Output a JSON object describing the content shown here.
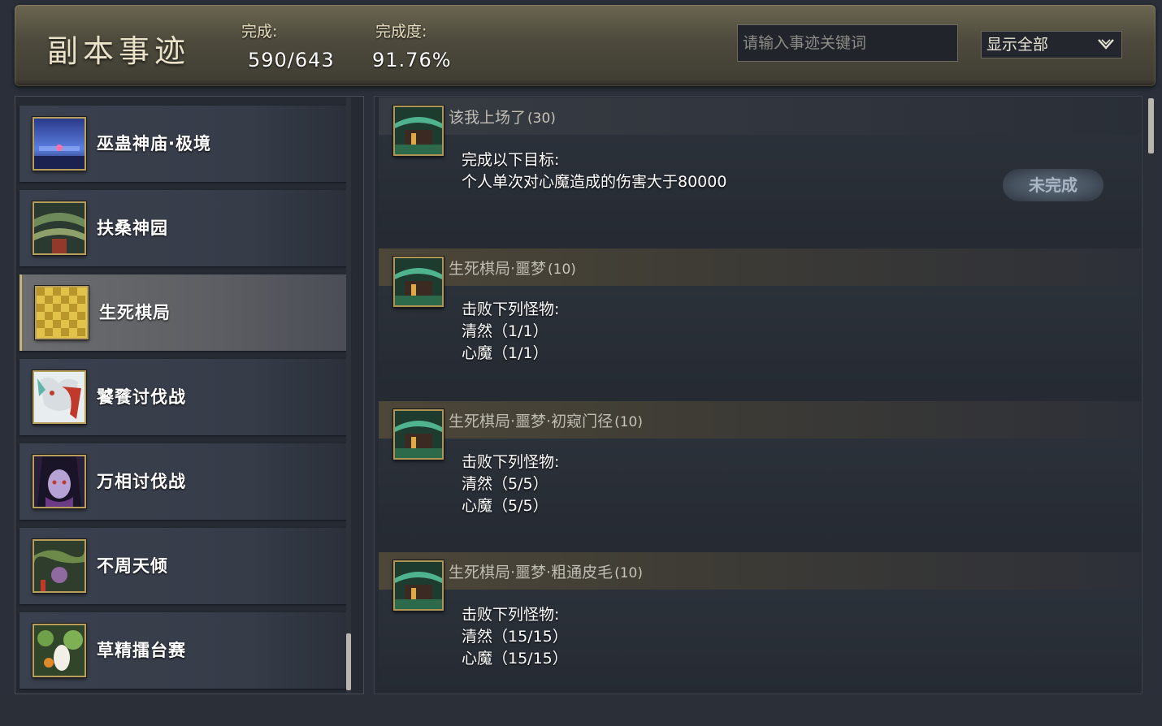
{
  "header": {
    "title": "副本事迹",
    "completed_label": "完成:",
    "completed_value": "590/643",
    "progress_label": "完成度:",
    "progress_value": "91.76%",
    "search_placeholder": "请输入事迹关键词",
    "filter_selected": "显示全部"
  },
  "dungeons": [
    {
      "name": "巫蛊神庙·极境",
      "icon": "temple-thumbnail"
    },
    {
      "name": "扶桑神园",
      "icon": "garden-thumbnail"
    },
    {
      "name": "生死棋局",
      "icon": "chessboard-thumbnail",
      "selected": true
    },
    {
      "name": "饕餮讨伐战",
      "icon": "taotie-thumbnail"
    },
    {
      "name": "万相讨伐战",
      "icon": "wanxiang-thumbnail"
    },
    {
      "name": "不周天倾",
      "icon": "buzhou-thumbnail"
    },
    {
      "name": "草精擂台赛",
      "icon": "grass-spirit-thumbnail"
    }
  ],
  "achievements": [
    {
      "title": "该我上场了",
      "points": "(30)",
      "lines": [
        "完成以下目标:",
        "个人单次对心魔造成的伤害大于80000"
      ],
      "status": "未完成"
    },
    {
      "title": "生死棋局·噩梦",
      "points": "(10)",
      "lines": [
        "击败下列怪物:",
        "清然（1/1）",
        "心魔（1/1）"
      ]
    },
    {
      "title": "生死棋局·噩梦·初窥门径",
      "points": "(10)",
      "lines": [
        "击败下列怪物:",
        "清然（5/5）",
        "心魔（5/5）"
      ]
    },
    {
      "title": "生死棋局·噩梦·粗通皮毛",
      "points": "(10)",
      "lines": [
        "击败下列怪物:",
        "清然（15/15）",
        "心魔（15/15）"
      ]
    }
  ]
}
